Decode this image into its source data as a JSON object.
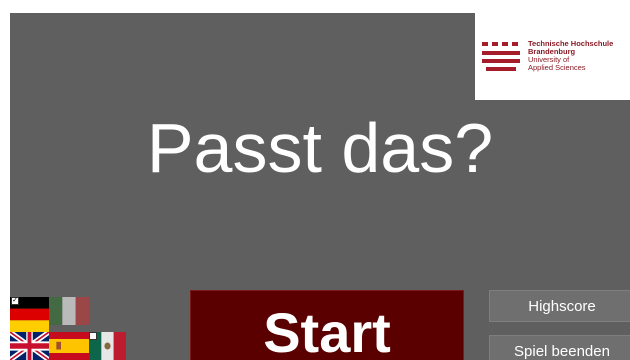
{
  "logo": {
    "line1": "Technische Hochschule",
    "line2": "Brandenburg",
    "line3": "University of",
    "line4": "Applied Sciences"
  },
  "title": "Passt das?",
  "buttons": {
    "start": "Start",
    "highscore": "Highscore",
    "quit": "Spiel beenden"
  },
  "languages": [
    {
      "name": "german-flag",
      "selected": true
    },
    {
      "name": "italian-flag",
      "selected": false
    },
    {
      "name": "uk-flag",
      "selected": false
    },
    {
      "name": "spanish-flag",
      "selected": false
    },
    {
      "name": "mexican-flag",
      "selected": false
    }
  ],
  "colors": {
    "background": "#5f5f5f",
    "start_button": "#5a0000",
    "side_button": "#6f6f6f",
    "brand": "#8a1a24"
  }
}
